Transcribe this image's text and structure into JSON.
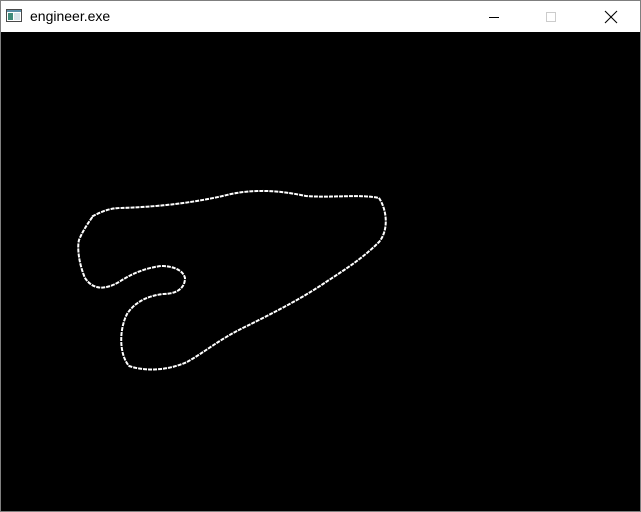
{
  "window": {
    "title": "engineer.exe",
    "controls": {
      "minimize_icon": "minimize-icon",
      "maximize_icon": "maximize-icon",
      "close_icon": "close-icon",
      "maximize_enabled": false
    }
  },
  "canvas": {
    "background": "#000000",
    "stroke_color": "#ffffff",
    "stroke_style": "dotted"
  }
}
